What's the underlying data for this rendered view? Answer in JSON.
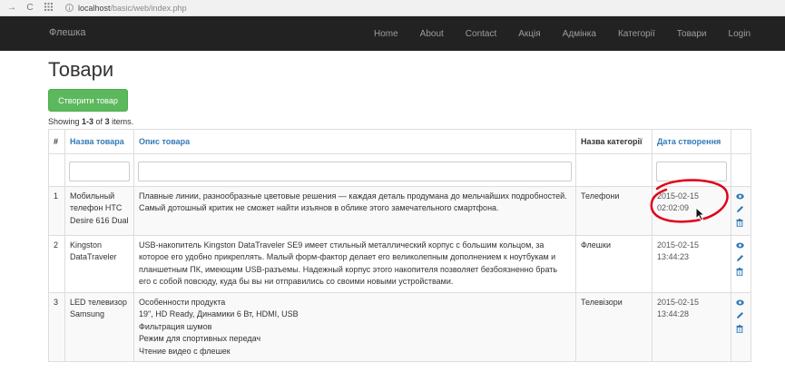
{
  "browser": {
    "back": "→",
    "reload": "C",
    "url_host": "localhost",
    "url_path": "/basic/web/index.php"
  },
  "navbar": {
    "brand": "Флешка",
    "items": [
      "Home",
      "About",
      "Contact",
      "Акція",
      "Адмінка",
      "Категорії",
      "Товари",
      "Login"
    ]
  },
  "page": {
    "title": "Товари",
    "create_button": "Створити товар",
    "summary_prefix": "Showing ",
    "summary_range": "1-3",
    "summary_of": " of ",
    "summary_total": "3",
    "summary_suffix": " items."
  },
  "table": {
    "headers": [
      "#",
      "Назва товара",
      "Опис товара",
      "Назва категорії",
      "Дата створення",
      ""
    ],
    "rows": [
      {
        "num": "1",
        "name": "Мобильный телефон HTC Desire 616 Dual",
        "description": "Плавные линии, разнообразные цветовые решения — каждая деталь продумана до мельчайших подробностей. Самый дотошный критик не сможет найти изъянов в облике этого замечательного смартфона.",
        "category": "Телефони",
        "date": "2015-02-15",
        "time": "02:02:09"
      },
      {
        "num": "2",
        "name": "Kingston DataTraveler",
        "description": "USB-накопитель Kingston DataTraveler SE9 имеет стильный металлический корпус с большим кольцом, за которое его удобно прикреплять. Малый форм-фактор делает его великолепным дополнением к ноутбукам и планшетным ПК, имеющим USB-разъемы. Надежный корпус этого накопителя позволяет безбоязненно брать его с собой повсюду, куда бы вы ни отправились со своими новыми устройствами.",
        "category": "Флешки",
        "date": "2015-02-15",
        "time": "13:44:23"
      },
      {
        "num": "3",
        "name": "LED телевизор Samsung",
        "description_lines": [
          "Особенности продукта",
          "19\", HD Ready, Динамики 6 Вт, HDMI, USB",
          "Фильтрация шумов",
          "Режим для спортивных передач",
          "Чтение видео с флешек"
        ],
        "category": "Телевізори",
        "date": "2015-02-15",
        "time": "13:44:28"
      }
    ]
  },
  "icons": {
    "view": "eye-icon",
    "update": "pencil-icon",
    "delete": "trash-icon"
  },
  "colors": {
    "navbar": "#222222",
    "button": "#5cb85c",
    "link": "#337ab7",
    "annotation": "#e0001a"
  }
}
